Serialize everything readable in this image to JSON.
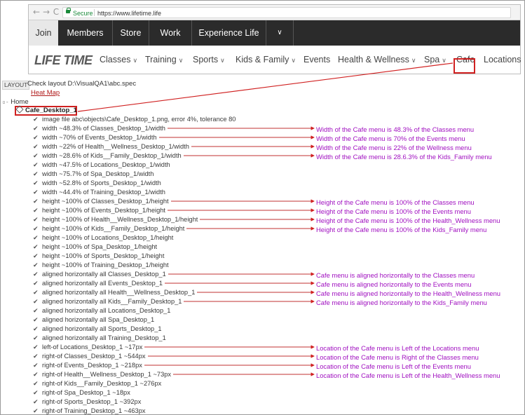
{
  "browser": {
    "secure_label": "Secure",
    "url": "https://www.lifetime.life",
    "back_icon": "←",
    "forward_icon": "→",
    "reload_icon": "C"
  },
  "topnav": {
    "items": [
      "Join",
      "Members",
      "Store",
      "Work",
      "Experience Life"
    ],
    "more_icon": "∨"
  },
  "mainnav": {
    "logo": "LIFE TIME",
    "items": [
      "Classes",
      "Training",
      "Sports",
      "Kids & Family",
      "Events",
      "Health & Wellness",
      "Spa",
      "Cafe",
      "Locations"
    ],
    "chevron_icon": "∨"
  },
  "report": {
    "layout_tag": "LAYOUT",
    "title": "Check layout D:\\VisualQA1\\abc.spec",
    "heat_map": "Heat Map",
    "home": "Home",
    "object": "Cafe_Desktop_1",
    "specs": [
      "image file abc\\objects\\Cafe_Desktop_1.png, error 4%, tolerance 80",
      "width ~48.3% of Classes_Desktop_1/width",
      "width ~70% of Events_Desktop_1/width",
      "width ~22% of Health__Wellness_Desktop_1/width",
      "width ~28.6% of Kids__Family_Desktop_1/width",
      "width ~47.5% of Locations_Desktop_1/width",
      "width ~75.7% of Spa_Desktop_1/width",
      "width ~52.8% of Sports_Desktop_1/width",
      "width ~44.4% of Training_Desktop_1/width",
      "height ~100% of Classes_Desktop_1/height",
      "height ~100% of Events_Desktop_1/height",
      "height ~100% of Health__Wellness_Desktop_1/height",
      "height ~100% of Kids__Family_Desktop_1/height",
      "height ~100% of Locations_Desktop_1/height",
      "height ~100% of Spa_Desktop_1/height",
      "height ~100% of Sports_Desktop_1/height",
      "height ~100% of Training_Desktop_1/height",
      "aligned horizontally all Classes_Desktop_1",
      "aligned horizontally all Events_Desktop_1",
      "aligned horizontally all Health__Wellness_Desktop_1",
      "aligned horizontally all Kids__Family_Desktop_1",
      "aligned horizontally all Locations_Desktop_1",
      "aligned horizontally all Spa_Desktop_1",
      "aligned horizontally all Sports_Desktop_1",
      "aligned horizontally all Training_Desktop_1",
      "left-of Locations_Desktop_1 ~17px",
      "right-of Classes_Desktop_1 ~544px",
      "right-of Events_Desktop_1 ~218px",
      "right-of Health__Wellness_Desktop_1 ~73px",
      "right-of Kids__Family_Desktop_1 ~276px",
      "right-of Spa_Desktop_1 ~18px",
      "right-of Sports_Desktop_1 ~392px",
      "right-of Training_Desktop_1 ~463px"
    ],
    "check_icon": "✔"
  },
  "annotations": [
    "Width of the Cafe menu is 48.3% of the Classes menu",
    "Width of the Cafe menu is 70% of the Events menu",
    "Width of the Cafe menu is 22% of the Wellness menu",
    "Width of the Cafe menu is 28.6.3% of the Kids_Family menu",
    "Height of the Cafe menu is 100% of the Classes menu",
    "Height of the Cafe menu is 100% of the Events menu",
    "Height of the Cafe menu is 100% of the Health_Wellness menu",
    "Height of the Cafe menu is 100% of the Kids_Family menu",
    "Cafe menu is aligned horizontally to the Classes menu",
    "Cafe menu is aligned horizontally to the Events menu",
    "Cafe menu is aligned horizontally to the Health_Wellness menu",
    "Cafe menu is aligned horizontally to the Kids_Family menu",
    "Location of the Cafe menu is Left of the Locations menu",
    "Location of the Cafe menu is Right of the Classes menu",
    "Location of the Cafe menu is Left of the Events menu",
    "Location of the Cafe menu is Left of the Health_Wellness menu"
  ],
  "colors": {
    "highlight": "#d02020",
    "annotation": "#a010c0",
    "topnav_bg": "#2b2b2b"
  }
}
